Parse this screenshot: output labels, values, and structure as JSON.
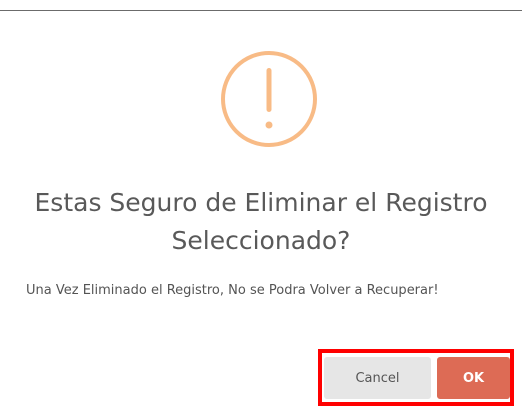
{
  "dialog": {
    "icon": "warning-exclamation-icon",
    "icon_color": "#f8bb86",
    "title": "Estas Seguro de Eliminar el Registro Seleccionado?",
    "message": "Una Vez Eliminado el Registro, No se Podra Volver a Recuperar!",
    "cancel_label": "Cancel",
    "confirm_label": "OK",
    "confirm_color": "#dd6b55",
    "highlight_color": "#ff0000"
  }
}
